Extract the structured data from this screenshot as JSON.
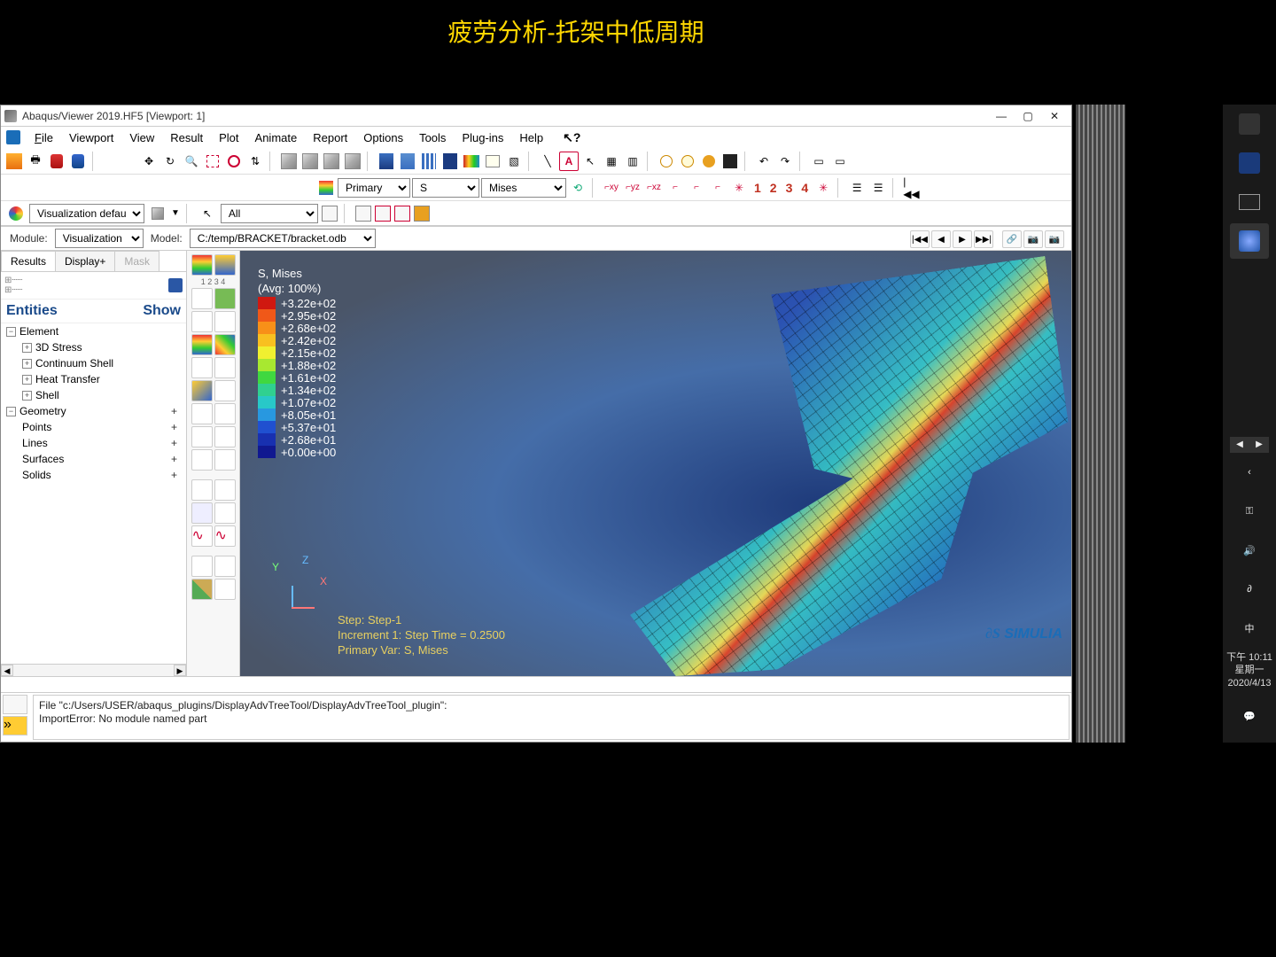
{
  "slide": {
    "title": "疲劳分析-托架中低周期"
  },
  "window": {
    "title": "Abaqus/Viewer 2019.HF5 [Viewport: 1]",
    "minimize": "—",
    "maximize": "▢",
    "close": "✕"
  },
  "menu": {
    "file": "File",
    "viewport": "Viewport",
    "view": "View",
    "result": "Result",
    "plot": "Plot",
    "animate": "Animate",
    "report": "Report",
    "options": "Options",
    "tools": "Tools",
    "plugins": "Plug-ins",
    "help": "Help",
    "q": "?"
  },
  "field_row": {
    "pos": "Primary",
    "var": "S",
    "comp": "Mises"
  },
  "viz_row": {
    "defaults_label": "Visualization defaults",
    "all": "All"
  },
  "context": {
    "module_label": "Module:",
    "module": "Visualization",
    "model_label": "Model:",
    "model": "C:/temp/BRACKET/bracket.odb"
  },
  "left": {
    "tabs": {
      "results": "Results",
      "displayp": "Display+",
      "mask": "Mask"
    },
    "entities": "Entities",
    "show": "Show",
    "tree": {
      "element": "Element",
      "stress3d": "3D Stress",
      "contshell": "Continuum Shell",
      "heat": "Heat Transfer",
      "shell": "Shell",
      "geometry": "Geometry",
      "points": "Points",
      "lines": "Lines",
      "surfaces": "Surfaces",
      "solids": "Solids"
    }
  },
  "legend": {
    "title1": "S, Mises",
    "title2": "(Avg: 100%)",
    "rows": [
      {
        "c": "#d01810",
        "v": "+3.22e+02"
      },
      {
        "c": "#f05818",
        "v": "+2.95e+02"
      },
      {
        "c": "#f89018",
        "v": "+2.68e+02"
      },
      {
        "c": "#f8c020",
        "v": "+2.42e+02"
      },
      {
        "c": "#f0f030",
        "v": "+2.15e+02"
      },
      {
        "c": "#a8e830",
        "v": "+1.88e+02"
      },
      {
        "c": "#40d840",
        "v": "+1.61e+02"
      },
      {
        "c": "#30d090",
        "v": "+1.34e+02"
      },
      {
        "c": "#28c8c8",
        "v": "+1.07e+02"
      },
      {
        "c": "#2898e0",
        "v": "+8.05e+01"
      },
      {
        "c": "#2050d0",
        "v": "+5.37e+01"
      },
      {
        "c": "#1830b0",
        "v": "+2.68e+01"
      },
      {
        "c": "#101890",
        "v": "+0.00e+00"
      }
    ]
  },
  "triad": {
    "x": "X",
    "y": "Y",
    "z": "Z"
  },
  "status": {
    "l1": "Step: Step-1",
    "l2": "Increment     1: Step Time =   0.2500",
    "l3": "Primary Var: S, Mises"
  },
  "watermark": "SIMULIA",
  "message": {
    "l1": "File \"c:/Users/USER/abaqus_plugins/DisplayAdvTreeTool/DisplayAdvTreeTool_plugin\":",
    "l2": "ImportError: No module named part"
  },
  "playback": {
    "first": "|◀◀",
    "prev": "◀",
    "play": "▶",
    "last": "▶▶|"
  },
  "csys_nums": [
    "1",
    "2",
    "3",
    "4"
  ],
  "taskbar": {
    "time": "下午 10:11",
    "day": "星期一",
    "date": "2020/4/13",
    "ime": "中"
  }
}
